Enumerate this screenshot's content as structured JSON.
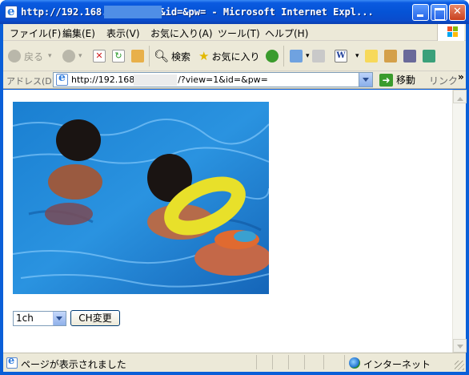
{
  "window": {
    "title": "http://192.168.          /?view=1&id=&pw= - Microsoft Internet Expl..."
  },
  "menu": {
    "items": [
      "ファイル(F)",
      "編集(E)",
      "表示(V)",
      "お気に入り(A)",
      "ツール(T)",
      "ヘルプ(H)"
    ]
  },
  "toolbar": {
    "back": "戻る",
    "search": "検索",
    "favorites": "お気に入り"
  },
  "address": {
    "label": "アドレス(D)",
    "url_prefix": "http://192.168",
    "url_suffix": "/?view=1&id=&pw=",
    "go": "移動",
    "links": "リンク",
    "more": "»"
  },
  "content": {
    "channel_selected": "1ch",
    "change_button": "CH変更"
  },
  "status": {
    "text": "ページが表示されました",
    "zone": "インターネット"
  },
  "colors": {
    "titlebar": "#0553d6",
    "chrome": "#ece9d8",
    "water": "#1a7fd1"
  }
}
